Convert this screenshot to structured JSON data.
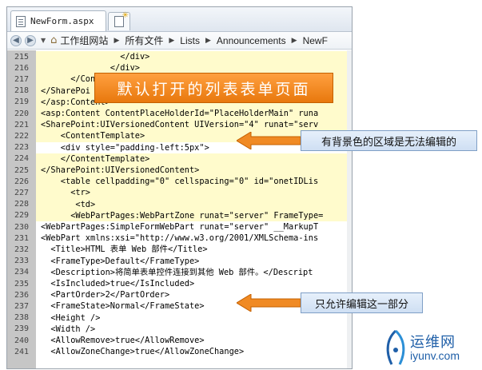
{
  "tab": {
    "title": "NewForm.aspx"
  },
  "breadcrumb": [
    "工作组网站",
    "所有文件",
    "Lists",
    "Announcements",
    "NewF"
  ],
  "lines": [
    {
      "n": "215",
      "hl": true,
      "code": "                </div>"
    },
    {
      "n": "216",
      "hl": true,
      "code": "              </div>"
    },
    {
      "n": "217",
      "hl": true,
      "code": "      </Content"
    },
    {
      "n": "218",
      "hl": true,
      "code": "</SharePoi"
    },
    {
      "n": "219",
      "hl": true,
      "code": "</asp:Content>"
    },
    {
      "n": "220",
      "hl": true,
      "code": "<asp:Content ContentPlaceHolderId=\"PlaceHolderMain\" runa"
    },
    {
      "n": "221",
      "hl": true,
      "code": "<SharePoint:UIVersionedContent UIVersion=\"4\" runat=\"serv"
    },
    {
      "n": "222",
      "hl": true,
      "code": "    <ContentTemplate>"
    },
    {
      "n": "223",
      "hl": false,
      "code": "    <div style=\"padding-left:5px\">"
    },
    {
      "n": "224",
      "hl": true,
      "code": "    </ContentTemplate>"
    },
    {
      "n": "225",
      "hl": true,
      "code": "</SharePoint:UIVersionedContent>"
    },
    {
      "n": "226",
      "hl": true,
      "code": "    <table cellpadding=\"0\" cellspacing=\"0\" id=\"onetIDLis"
    },
    {
      "n": "227",
      "hl": true,
      "code": "      <tr>"
    },
    {
      "n": "228",
      "hl": true,
      "code": "       <td>"
    },
    {
      "n": "229",
      "hl": true,
      "code": "      <WebPartPages:WebPartZone runat=\"server\" FrameType="
    },
    {
      "n": "230",
      "hl": false,
      "code": "<WebPartPages:SimpleFormWebPart runat=\"server\" __MarkupT"
    },
    {
      "n": "231",
      "hl": false,
      "code": "<WebPart xmlns:xsi=\"http://www.w3.org/2001/XMLSchema-ins"
    },
    {
      "n": "232",
      "hl": false,
      "code": "  <Title>HTML 表单 Web 部件</Title>"
    },
    {
      "n": "233",
      "hl": false,
      "code": "  <FrameType>Default</FrameType>"
    },
    {
      "n": "234",
      "hl": false,
      "code": "  <Description>将简单表单控件连接到其他 Web 部件。</Descript"
    },
    {
      "n": "235",
      "hl": false,
      "code": "  <IsIncluded>true</IsIncluded>"
    },
    {
      "n": "236",
      "hl": false,
      "code": "  <PartOrder>2</PartOrder>"
    },
    {
      "n": "237",
      "hl": false,
      "code": "  <FrameState>Normal</FrameState>"
    },
    {
      "n": "238",
      "hl": false,
      "code": "  <Height />"
    },
    {
      "n": "239",
      "hl": false,
      "code": "  <Width />"
    },
    {
      "n": "240",
      "hl": false,
      "code": "  <AllowRemove>true</AllowRemove>"
    },
    {
      "n": "241",
      "hl": false,
      "code": "  <AllowZoneChange>true</AllowZoneChange>"
    }
  ],
  "callouts": {
    "title": "默认打开的列表表单页面",
    "bg_note": "有背景色的区域是无法编辑的",
    "edit_note": "只允许编辑这一部分"
  },
  "watermark": {
    "cn": "运维网",
    "en": "iyunv.com"
  },
  "colors": {
    "readonly_bg": "#fffbcc",
    "gutter": "#c6c6c6",
    "orange": "#f08a24",
    "note_bg": "#dce8f7"
  }
}
